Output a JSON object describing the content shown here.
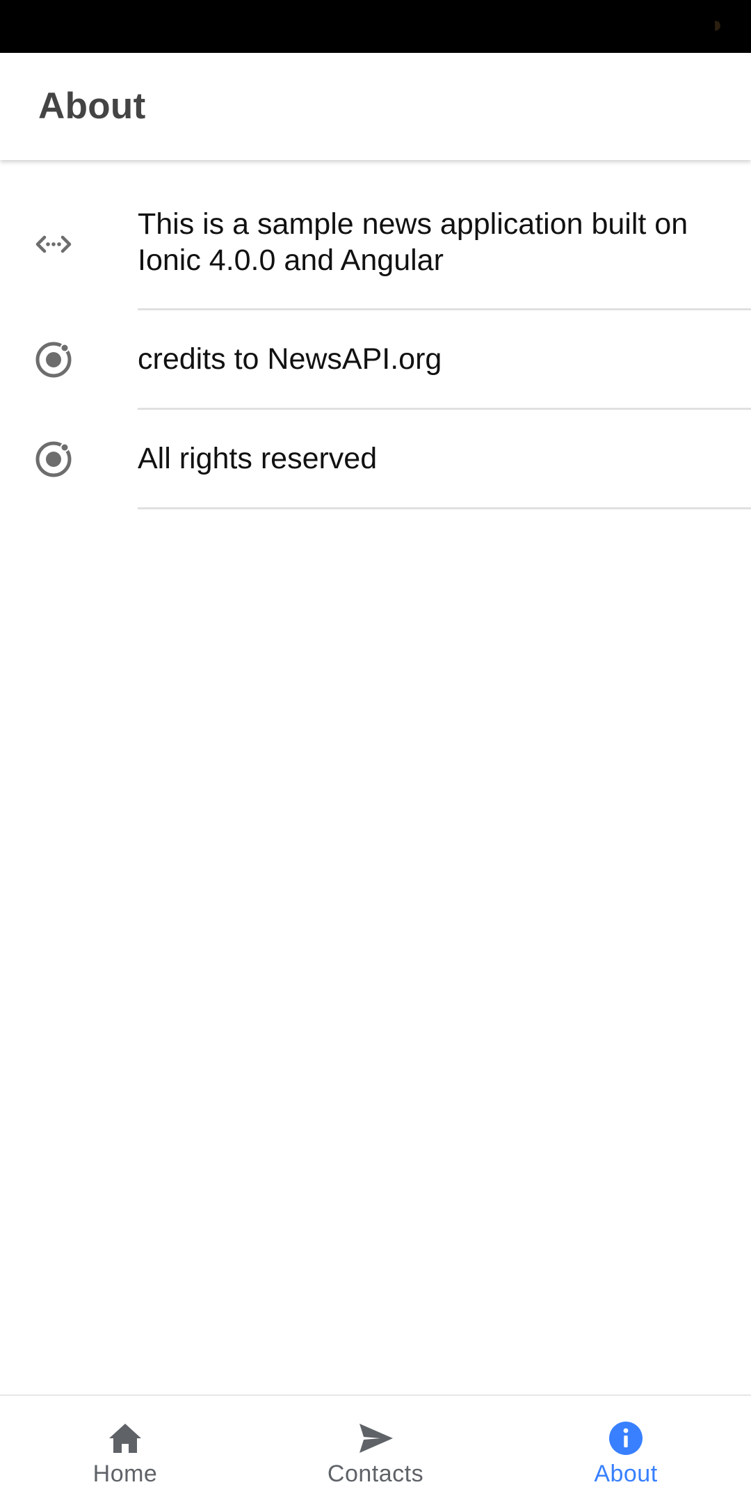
{
  "header": {
    "title": "About"
  },
  "items": [
    {
      "icon": "code-icon",
      "text": "This is a sample news application built on Ionic 4.0.0 and Angular"
    },
    {
      "icon": "ionic-icon",
      "text": "credits to NewsAPI.org"
    },
    {
      "icon": "ionic-icon",
      "text": "All rights reserved"
    }
  ],
  "tabs": [
    {
      "label": "Home",
      "icon": "home-icon",
      "active": false
    },
    {
      "label": "Contacts",
      "icon": "send-icon",
      "active": false
    },
    {
      "label": "About",
      "icon": "info-icon",
      "active": true
    }
  ],
  "colors": {
    "accent": "#3880ff",
    "icon": "#6d6d6d",
    "tab_inactive": "#5f6368",
    "title": "#444444",
    "text": "#111111",
    "divider": "#e0e0e0"
  }
}
